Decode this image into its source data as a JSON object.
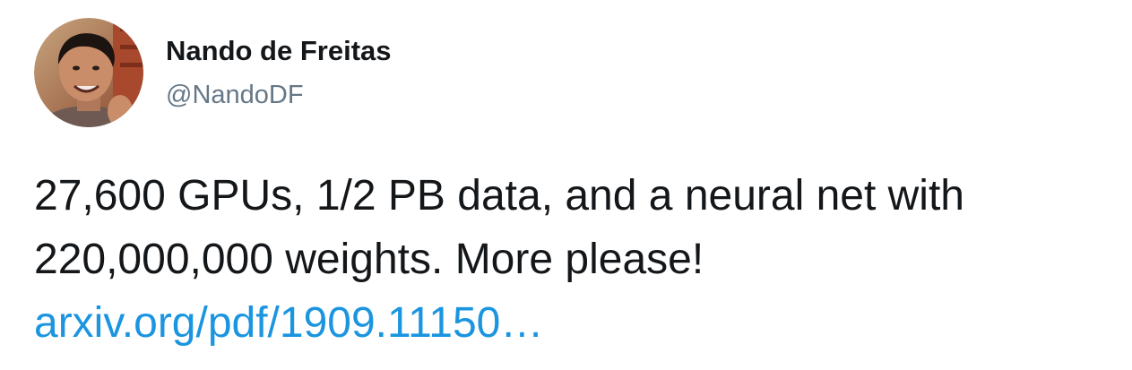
{
  "author": {
    "display_name": "Nando de Freitas",
    "handle": "@NandoDF",
    "avatar_icon": "user-avatar-photo"
  },
  "tweet": {
    "lines": [
      "27,600 GPUs, 1/2 PB data, and a neural net with",
      "220,000,000 weights. More please!"
    ],
    "link_text": "arxiv.org/pdf/1909.11150…"
  },
  "colors": {
    "text": "#14171a",
    "handle": "#657786",
    "link": "#1b95e0",
    "background": "#ffffff"
  }
}
